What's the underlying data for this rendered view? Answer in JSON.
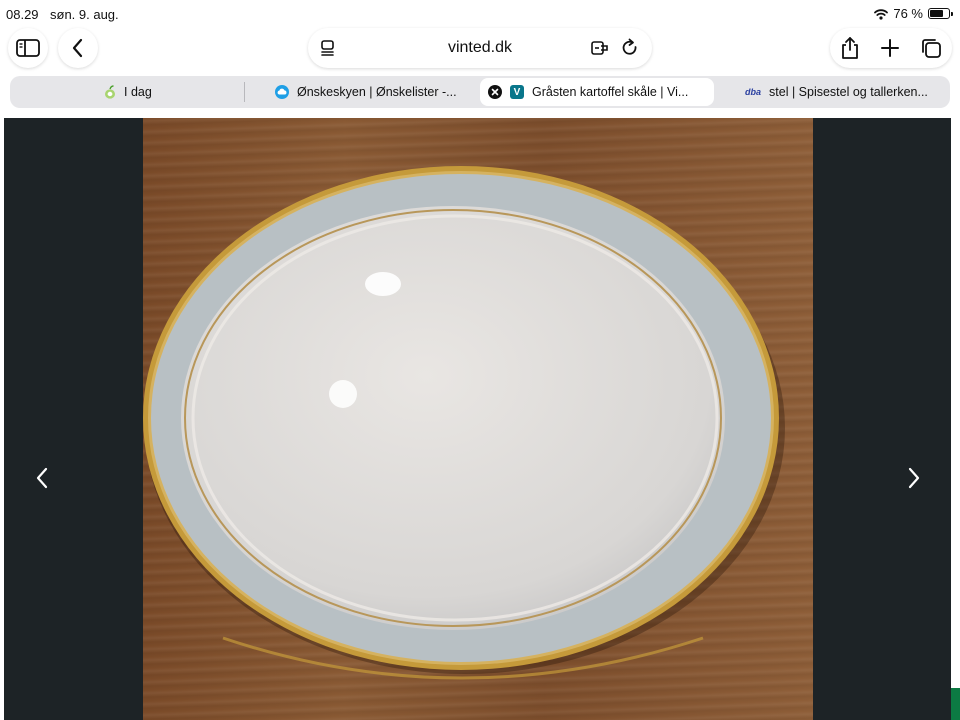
{
  "status_bar": {
    "time": "08.29",
    "date": "søn. 9. aug.",
    "battery_percent_label": "76 %",
    "battery_level": 0.76
  },
  "toolbar": {
    "url": "vinted.dk",
    "icons": [
      "sidebar-icon",
      "back-icon",
      "reader-icon",
      "translate-icon",
      "reload-icon",
      "share-icon",
      "new-tab-icon",
      "tabs-icon"
    ]
  },
  "tabs": [
    {
      "title": "I dag",
      "favicon": "apple-icon",
      "active": false
    },
    {
      "title": "Ønskeskyen | Ønskelister -...",
      "favicon": "cloud-icon",
      "active": false
    },
    {
      "title": "Gråsten kartoffel skåle | Vi...",
      "favicon": "vinted-icon",
      "favicon_letter": "V",
      "active": true
    },
    {
      "title": "stel | Spisestel og tallerken...",
      "favicon": "dba-icon",
      "favicon_text": "dba",
      "active": false
    }
  ],
  "gallery": {
    "image": "photo of a white porcelain dish with a light grey-blue rim and gold edge on a wooden table",
    "prev_icon": "chevron-left-icon",
    "next_icon": "chevron-right-icon"
  },
  "colors": {
    "accent_blue": "#1f9fe6",
    "vinted_teal": "#09768b",
    "dba_blue": "#2a3fa0",
    "gallery_bg": "#1d2326"
  }
}
